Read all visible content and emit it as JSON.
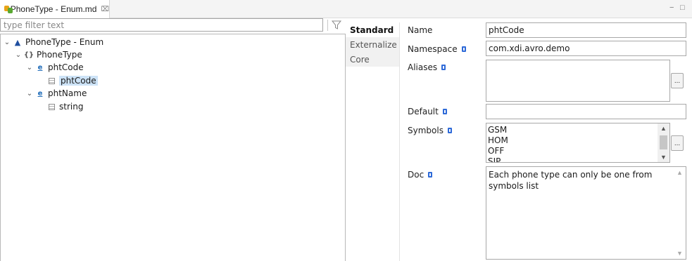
{
  "editor_tab": {
    "title": "PhoneType - Enum.md",
    "close_glyph": "⌧"
  },
  "window_controls": {
    "minimize": "−",
    "maximize": "□"
  },
  "filter": {
    "placeholder": "type filter text",
    "icon": "filter-icon"
  },
  "tree": {
    "root": {
      "label": "PhoneType - Enum",
      "icon": "enum-icon",
      "expanded": true
    },
    "type_node": {
      "label": "PhoneType",
      "icon": "struct-icon",
      "expanded": true
    },
    "field1": {
      "label": "phtCode",
      "icon": "field-icon",
      "expanded": true
    },
    "field1_child": {
      "label": "phtCode",
      "icon": "type-icon",
      "selected": true
    },
    "field2": {
      "label": "phtName",
      "icon": "field-icon",
      "expanded": true
    },
    "field2_child": {
      "label": "string",
      "icon": "type-icon",
      "selected": false
    }
  },
  "section_tabs": [
    {
      "label": "Standard",
      "active": true
    },
    {
      "label": "Externalize",
      "active": false
    },
    {
      "label": "Core",
      "active": false
    }
  ],
  "form": {
    "name": {
      "label": "Name",
      "value": "phtCode"
    },
    "namespace": {
      "label": "Namespace",
      "value": "com.xdi.avro.demo"
    },
    "aliases": {
      "label": "Aliases",
      "value": "",
      "button": "..."
    },
    "default": {
      "label": "Default",
      "value": ""
    },
    "symbols": {
      "label": "Symbols",
      "items": [
        "GSM",
        "HOM",
        "OFF",
        "SIP"
      ],
      "button": "..."
    },
    "doc": {
      "label": "Doc",
      "value": "Each phone type can only be one from symbols list"
    }
  },
  "colors": {
    "selection": "#cde3f7",
    "info_icon": "#2e6ad8",
    "border": "#a8a8a8"
  }
}
